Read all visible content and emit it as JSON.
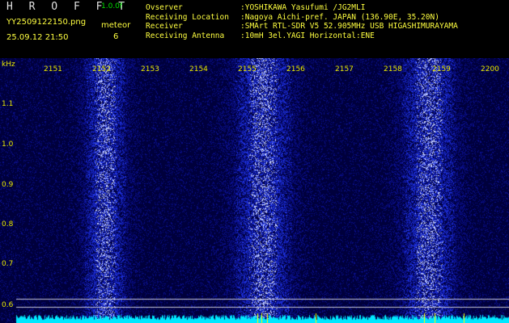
{
  "header": {
    "app_title": "H R O F F T",
    "version": "1.0.0f",
    "filename": "YY2509122150.png",
    "datetime": "25.09.12 21:50",
    "meteor_label": "meteor",
    "meteor_count": "6"
  },
  "info": [
    {
      "key": "Ovserver",
      "value": ":YOSHIKAWA Yasufumi /JG2MLI"
    },
    {
      "key": "Receiving Location",
      "value": ":Nagoya Aichi-pref. JAPAN (136.90E, 35.20N)"
    },
    {
      "key": "Receiver",
      "value": ":SMArt RTL-SDR V5 52.905MHz USB HIGASHIMURAYAMA"
    },
    {
      "key": "Receiving Antenna",
      "value": ":10mH 3el.YAGI Horizontal:ENE"
    }
  ],
  "axis": {
    "y_unit": "kHz",
    "y_ticks": [
      "1.1",
      "1.0",
      "0.9",
      "0.8",
      "0.7",
      "0.6"
    ],
    "x_ticks": [
      "2151",
      "2152",
      "2153",
      "2154",
      "2155",
      "2156",
      "2157",
      "2158",
      "2159",
      "2200"
    ]
  },
  "colors": {
    "header_green": "#00e000",
    "info_yellow": "#ffff40",
    "label_yellow": "#e8e800",
    "title_white": "#e0e0e0",
    "spectrum_bg": "#00003a",
    "noise_cyan": "#00e8ff",
    "marker_yellow": "#ffff00"
  }
}
